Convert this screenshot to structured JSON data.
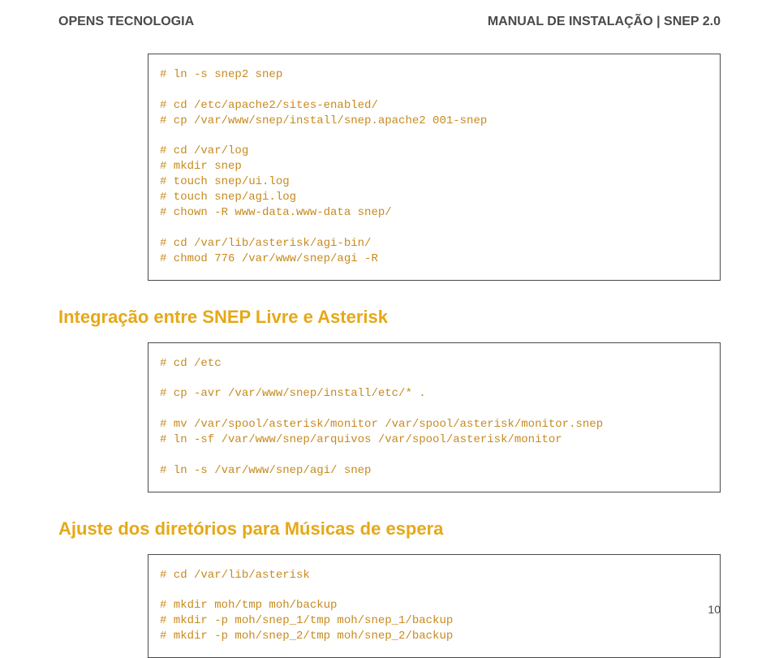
{
  "header": {
    "left": "OPENS TECNOLOGIA",
    "right": "MANUAL DE INSTALAÇÃO | SNEP 2.0"
  },
  "codeBlock1": "# ln -s snep2 snep\n\n# cd /etc/apache2/sites-enabled/\n# cp /var/www/snep/install/snep.apache2 001-snep\n\n# cd /var/log\n# mkdir snep\n# touch snep/ui.log\n# touch snep/agi.log\n# chown -R www-data.www-data snep/\n\n# cd /var/lib/asterisk/agi-bin/\n# chmod 776 /var/www/snep/agi -R",
  "section1": "Integração entre SNEP Livre e Asterisk",
  "codeBlock2": "# cd /etc\n\n# cp -avr /var/www/snep/install/etc/* .\n\n# mv /var/spool/asterisk/monitor /var/spool/asterisk/monitor.snep\n# ln -sf /var/www/snep/arquivos /var/spool/asterisk/monitor\n\n# ln -s /var/www/snep/agi/ snep",
  "section2": "Ajuste dos diretórios para Músicas de espera",
  "codeBlock3": "# cd /var/lib/asterisk\n\n# mkdir moh/tmp moh/backup\n# mkdir -p moh/snep_1/tmp moh/snep_1/backup\n# mkdir -p moh/snep_2/tmp moh/snep_2/backup",
  "pageNumber": "10"
}
